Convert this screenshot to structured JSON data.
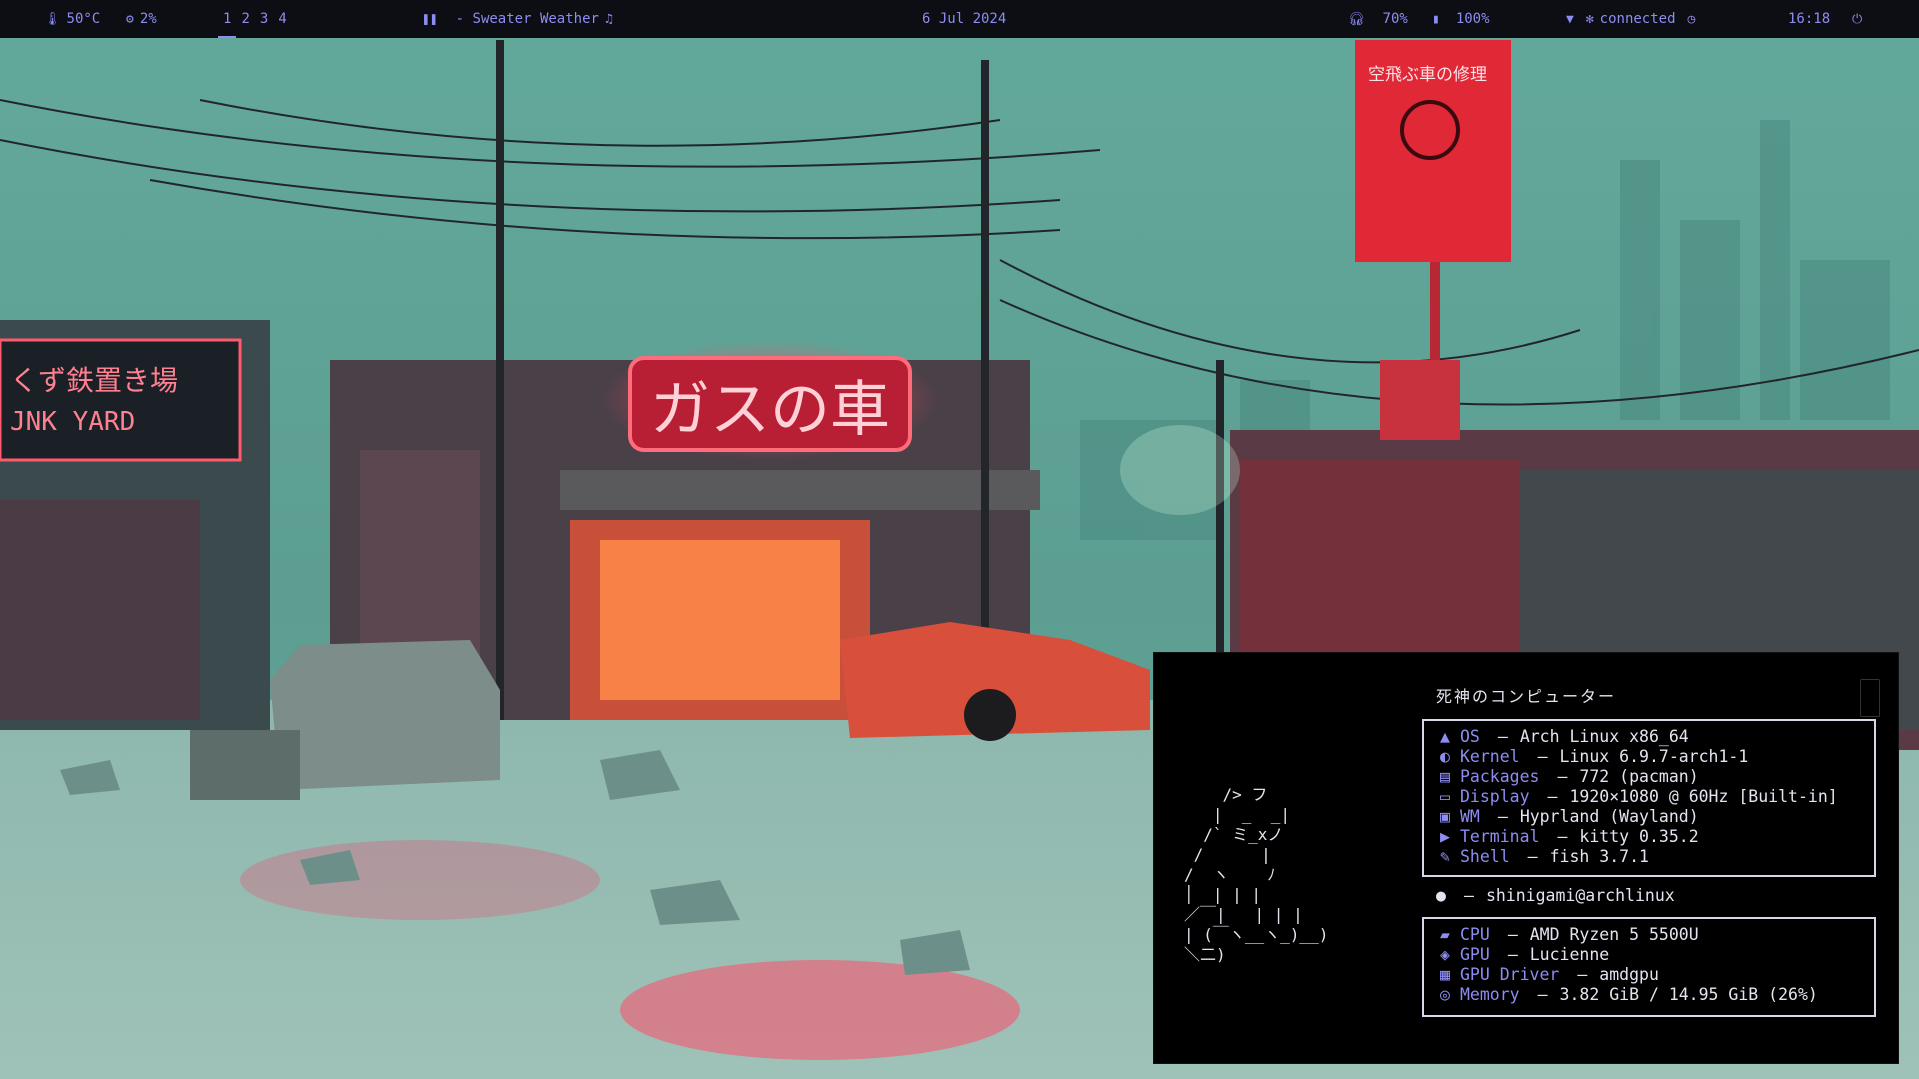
{
  "bar": {
    "cpu_temp": "50°C",
    "cpu_usage": "2%",
    "workspaces": [
      "1",
      "2",
      "3",
      "4"
    ],
    "active_workspace": "1",
    "music": "- Sweater Weather",
    "date": "6 Jul 2024",
    "volume": "70%",
    "battery": "100%",
    "network": "connected",
    "clock": "16:18",
    "accent": "#8d8cf2",
    "background": "#0d0d14"
  },
  "wallpaper": {
    "sign_main": "ガスの車",
    "sign_left": "くず鉄置き場",
    "sign_left_sub": "JNK YARD",
    "billboard": "空飛ぶ車の修理"
  },
  "terminal": {
    "title": "死神のコンピューター",
    "ascii": "    /> フ\n   |  _  _|\n  /` ミ_xノ\n /      |\n/  ヽ    ﾉ\n│  | | |\n／￣|   | | |\n| (￣ヽ__ヽ_)__)\n＼二)",
    "info": [
      {
        "icon": "arch-icon",
        "glyph": "▲",
        "key": "OS",
        "value": "Arch Linux x86_64"
      },
      {
        "icon": "kernel-icon",
        "glyph": "◐",
        "key": "Kernel",
        "value": "Linux 6.9.7-arch1-1"
      },
      {
        "icon": "package-icon",
        "glyph": "▤",
        "key": "Packages",
        "value": "772 (pacman)"
      },
      {
        "icon": "display-icon",
        "glyph": "▭",
        "key": "Display",
        "value": "1920×1080 @ 60Hz [Built-in]"
      },
      {
        "icon": "wm-icon",
        "glyph": "▣",
        "key": "WM",
        "value": "Hyprland (Wayland)"
      },
      {
        "icon": "terminal-icon",
        "glyph": "▶",
        "key": "Terminal",
        "value": "kitty 0.35.2"
      },
      {
        "icon": "shell-icon",
        "glyph": "✎",
        "key": "Shell",
        "value": "fish 3.7.1"
      }
    ],
    "user": "shinigami@archlinux",
    "hardware": [
      {
        "icon": "cpu-icon",
        "glyph": "▰",
        "key": "CPU",
        "value": "AMD Ryzen 5 5500U"
      },
      {
        "icon": "gpu-icon",
        "glyph": "◈",
        "key": "GPU",
        "value": "Lucienne"
      },
      {
        "icon": "driver-icon",
        "glyph": "▦",
        "key": "GPU Driver",
        "value": "amdgpu"
      },
      {
        "icon": "memory-icon",
        "glyph": "◎",
        "key": "Memory",
        "value": "3.82 GiB / 14.95 GiB (26%)"
      }
    ]
  }
}
